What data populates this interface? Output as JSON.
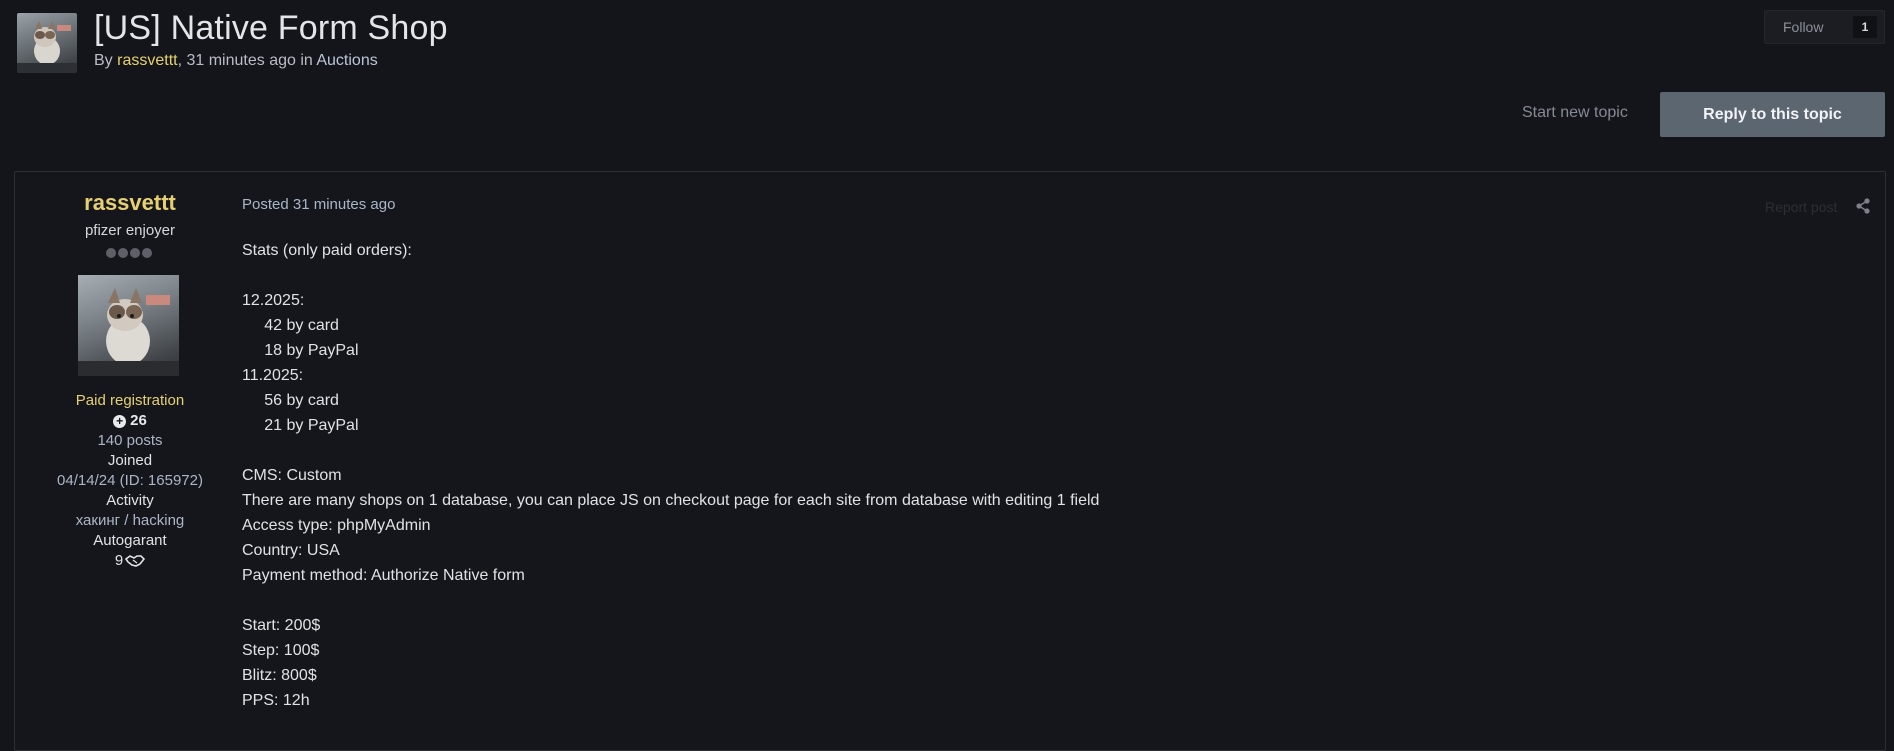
{
  "topic": {
    "title": "[US] Native Form Shop",
    "meta_prefix": "By ",
    "author": "rassvettt",
    "meta_time": ", 31 minutes ago in ",
    "forum": "Auctions"
  },
  "follow": {
    "label": "Follow",
    "count": "1"
  },
  "actions": {
    "start_new_topic": "Start new topic",
    "reply": "Reply to this topic"
  },
  "post": {
    "author": {
      "name": "rassvettt",
      "title": "pfizer enjoyer",
      "group": "Paid registration",
      "reputation": "26",
      "posts": "140 posts",
      "joined_label": "Joined",
      "joined_value": "04/14/24 (ID: 165972)",
      "activity_label": "Activity",
      "activity_value": "хакинг / hacking",
      "autogarant_label": "Autogarant",
      "autogarant_value": "9"
    },
    "posted": "Posted 31 minutes ago",
    "report": "Report post",
    "lines": [
      "Stats (only paid orders):",
      "",
      "12.2025:",
      "     42 by card",
      "     18 by PayPal",
      "11.2025:",
      "     56 by card",
      "     21 by PayPal",
      "",
      "CMS: Custom",
      "There are many shops on 1 database, you can place JS on checkout page for each site from database with editing 1 field",
      "Access type: phpMyAdmin",
      "Country: USA",
      "Payment method: Authorize Native form",
      "",
      "Start: 200$",
      "Step: 100$",
      "Blitz: 800$",
      "PPS: 12h"
    ]
  }
}
